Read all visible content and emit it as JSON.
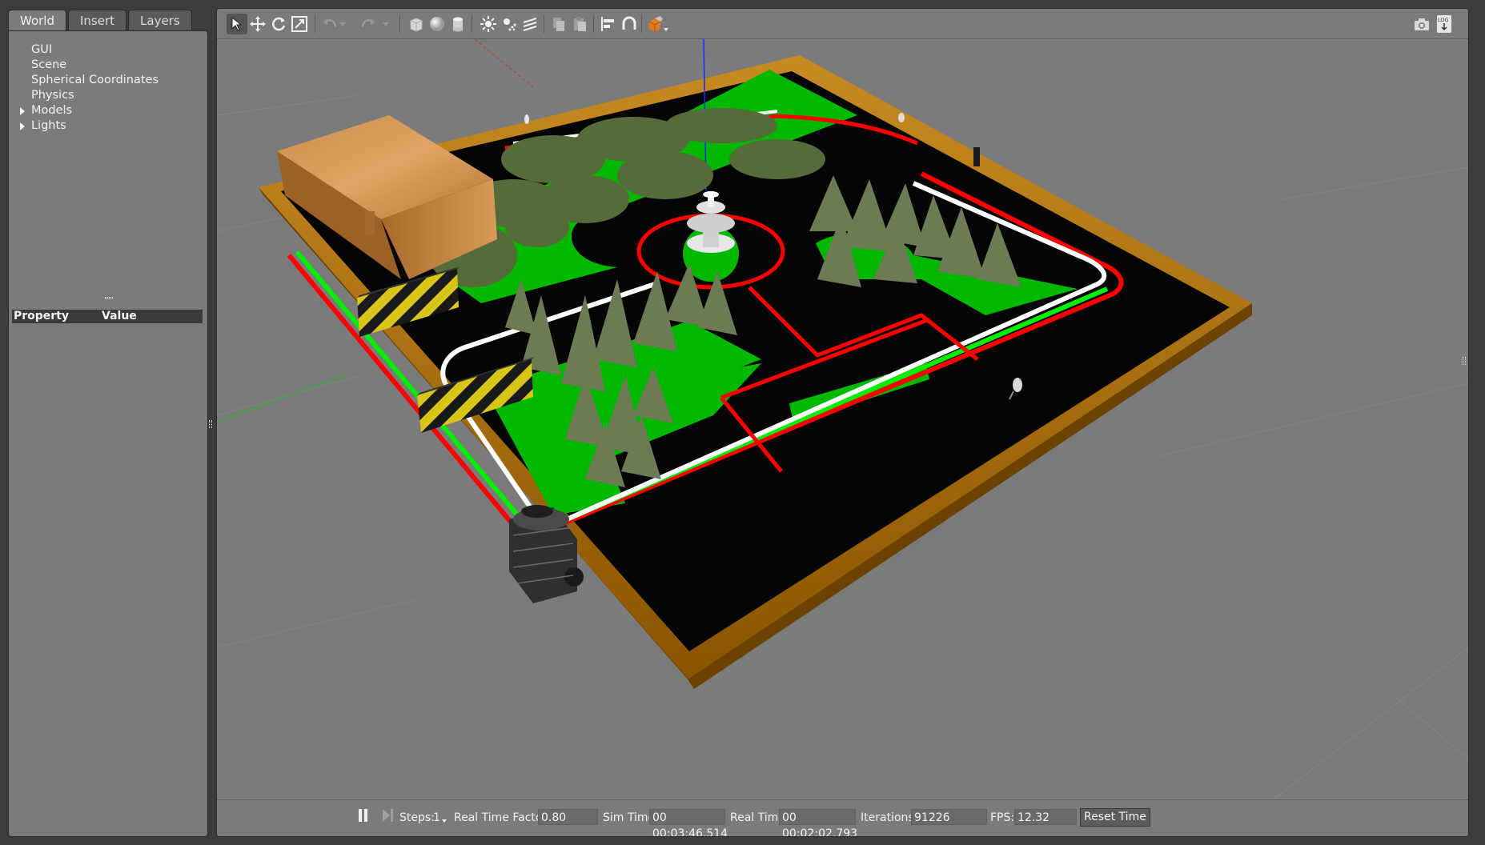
{
  "left_panel": {
    "tabs": [
      {
        "label": "World"
      },
      {
        "label": "Insert"
      },
      {
        "label": "Layers"
      }
    ],
    "tree": [
      {
        "label": "GUI",
        "expandable": false
      },
      {
        "label": "Scene",
        "expandable": false
      },
      {
        "label": "Spherical Coordinates",
        "expandable": false
      },
      {
        "label": "Physics",
        "expandable": false
      },
      {
        "label": "Models",
        "expandable": true
      },
      {
        "label": "Lights",
        "expandable": true
      }
    ],
    "properties": {
      "col_property": "Property",
      "col_value": "Value"
    }
  },
  "toolbar": {
    "tools": [
      "select-arrow-icon",
      "translate-icon",
      "rotate-icon",
      "scale-icon",
      "undo-icon",
      "undo-history-icon",
      "redo-icon",
      "redo-history-icon",
      "box-icon",
      "sphere-icon",
      "cylinder-icon",
      "point-light-icon",
      "spot-light-icon",
      "directional-light-icon",
      "copy-icon",
      "paste-icon",
      "align-icon",
      "snap-icon",
      "view-angle-icon"
    ],
    "right_tools": [
      "screenshot-icon",
      "log-icon"
    ],
    "log_label": "LOG",
    "accent": "#e07a1f"
  },
  "scene": {
    "description": "3D simulation world viewport",
    "colors": {
      "grass": "#00b800",
      "road": "#050505",
      "frame": "#7a4a00",
      "lane_red": "#ff0000",
      "lane_white": "#ffffff",
      "lane_green": "#00ee00"
    }
  },
  "bottom_bar": {
    "steps_label": "Steps:",
    "steps_value": "1",
    "rtf_label": "Real Time Factor:",
    "rtf_value": "0.80",
    "sim_time_label": "Sim Time:",
    "sim_time_value": "00 00:03:46.514",
    "real_time_label": "Real Time:",
    "real_time_value": "00 00:02:02.793",
    "iterations_label": "Iterations:",
    "iterations_value": "91226",
    "fps_label": "FPS:",
    "fps_value": "12.32",
    "reset_label": "Reset Time"
  }
}
